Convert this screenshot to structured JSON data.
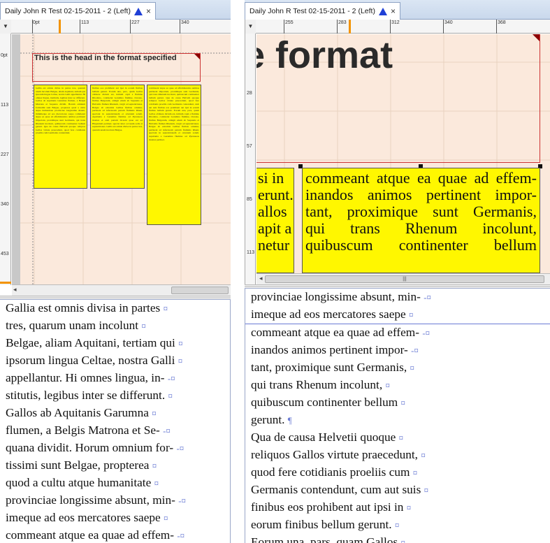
{
  "left": {
    "tab_title": "Daily John R Test 02-15-2011 - 2 (Left)",
    "tab_close": "×",
    "ruler_zero": "0pt",
    "ruler_h": [
      "113",
      "227",
      "340"
    ],
    "ruler_v": [
      "0pt",
      "113",
      "227",
      "340",
      "453"
    ],
    "headline": "This is the head in the format specified",
    "col1_text": "Gallia est omnis divisa in partes tres, quarum unam incolunt Belgae, aliam Aquitani, tertiam qui ipsorum lingua Celtae, nostra Galli appellantur. Hi omnes lingua, institutis, legibus inter se differunt. Gallos ab Aquitanis Garumna flumen, a Belgis Matrona et Sequana dividit. Horum omnium fortissimi sunt Belgae, propterea quod a cultu atque humanitate provinciae longissime absunt, minimeque ad eos mercatores saepe commeant atque ea quae ad effeminandos animos pertinent important, proximique sunt Germanis, qui trans Rhenum incolunt, quibuscum continenter bellum gerunt. Qua de causa Helvetii quoque reliquos Gallos virtute praecedunt, quod fere cotidianis proeliis cum Germanis contendunt.",
    "col2_text": "finibus eos prohibent aut ipsi in eorum finibus bellum gerunt. Eorum una, pars, quam Gallos obtinere dictum est, initium capit a flumine Rhodano, continetur Garumna flumine, Oceano, finibus Belgarum, attingit etiam ab Sequanis et Helvetiis flumen Rhenum, vergit ad septentriones. Belgae ab extremis Galliae finibus oriuntur, pertinent ad inferiorem partem fluminis Rheni, spectant in septentrionem et orientem solem. Aquitania a Garumna flumine ad Pyrenaeos montes et eam partem Oceani quae est ad Hispaniam pertinet; spectat inter occasum solis et septentriones. Gallia est omnis divisa in partes tres, quarum unam incolunt Belgae.",
    "col3_text": "commeant atque ea quae ad effeminandos animos pertinent important, proximique sunt Germanis, qui trans Rhenum incolunt, quibuscum continenter bellum gerunt. Qua de causa Helvetii quoque reliquos Gallos virtute praecedunt, quod fere cotidianis proeliis cum Germanis contendunt, cum aut suis finibus eos prohibent aut ipsi in eorum finibus bellum gerunt. Eorum una, pars, quam Gallos obtinere dictum est, initium capit a flumine Rhodano, continetur Garumna flumine, Oceano, finibus Belgarum, attingit etiam ab Sequanis et Helvetiis flumen Rhenum, vergit ad septentriones. Belgae ab extremis Galliae finibus oriuntur, pertinent ad inferiorem partem fluminis Rheni, spectant in septentrionem et orientem solem. Aquitania a Garumna flumine ad Pyrenaeos montes pertinet.",
    "story_lines": [
      {
        "text": "Gallia est omnis divisa in partes",
        "mark": "¤"
      },
      {
        "text": "tres, quarum unam incolunt",
        "mark": "¤"
      },
      {
        "text": "Belgae, aliam Aquitani, tertiam qui",
        "mark": "¤"
      },
      {
        "text": "ipsorum lingua Celtae, nostra Galli",
        "mark": "¤"
      },
      {
        "text": "appellantur. Hi omnes lingua, in-",
        "mark": "-¤"
      },
      {
        "text": "stitutis, legibus inter se differunt.",
        "mark": "¤"
      },
      {
        "text": "Gallos ab Aquitanis Garumna",
        "mark": "¤"
      },
      {
        "text": "flumen, a Belgis Matrona et Se-",
        "mark": "-¤"
      },
      {
        "text": "quana dividit. Horum omnium for-",
        "mark": "-¤"
      },
      {
        "text": "tissimi sunt Belgae, propterea",
        "mark": "¤"
      },
      {
        "text": "quod a cultu atque humanitate",
        "mark": "¤"
      },
      {
        "text": "provinciae longissime absunt, min-",
        "mark": "-¤"
      },
      {
        "text": "imeque ad eos mercatores saepe",
        "mark": "¤"
      },
      {
        "text": "commeant atque ea quae ad effem-",
        "mark": "-¤"
      },
      {
        "text": "inandos animos pertinent impor-",
        "mark": "-¤"
      }
    ]
  },
  "right": {
    "tab_title": "Daily John R Test 02-15-2011 - 2 (Left)",
    "tab_close": "×",
    "ruler_h": [
      "255",
      "283",
      "312",
      "340",
      "368"
    ],
    "ruler_v": [
      "28",
      "57",
      "85",
      "113"
    ],
    "headline_fragment": "e format",
    "frame_left_lines": [
      "si in",
      "erunt.",
      "allos",
      "apit a",
      "netur"
    ],
    "frame_right_lines": [
      "commeant atque ea quae ad effem-",
      "inandos animos pertinent impor-",
      "tant, proximique sunt Germanis,",
      "qui trans Rhenum incolunt,",
      "quibuscum continenter bellum"
    ],
    "scroll_grip": "|||",
    "story_lines": [
      {
        "text": "provinciae longissime absunt, min-",
        "mark": "-¤"
      },
      {
        "text": "imeque ad eos mercatores saepe",
        "mark": "¤"
      },
      {
        "text": "commeant atque ea quae ad effem-",
        "mark": "-¤"
      },
      {
        "text": "inandos animos pertinent impor-",
        "mark": "-¤"
      },
      {
        "text": "tant, proximique sunt Germanis,",
        "mark": "¤"
      },
      {
        "text": "qui trans Rhenum incolunt,",
        "mark": "¤"
      },
      {
        "text": "quibuscum continenter bellum",
        "mark": "¤"
      },
      {
        "text": "gerunt.",
        "mark": "¶"
      },
      {
        "text": "Qua de causa Helvetii quoque",
        "mark": "¤"
      },
      {
        "text": "reliquos Gallos virtute praecedunt,",
        "mark": "¤"
      },
      {
        "text": "quod fere cotidianis proeliis cum",
        "mark": "¤"
      },
      {
        "text": "Germanis contendunt, cum aut suis",
        "mark": "¤"
      },
      {
        "text": "finibus eos prohibent aut ipsi in",
        "mark": "¤"
      },
      {
        "text": "eorum finibus bellum gerunt.",
        "mark": "¤"
      },
      {
        "text": "Eorum una, pars, quam Gallos",
        "mark": "¤"
      }
    ]
  },
  "colors": {
    "frame_yellow": "#fff700",
    "page_bg": "#fbe9dc",
    "accent_blue": "#1f3fd6",
    "ruler_orange": "#f29300",
    "pilcrow": "#6a7bd4"
  }
}
